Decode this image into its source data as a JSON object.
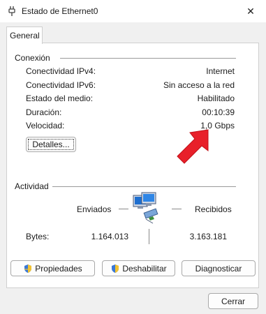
{
  "window": {
    "title": "Estado de Ethernet0",
    "close": "✕"
  },
  "tabs": [
    {
      "label": "General"
    }
  ],
  "connection": {
    "heading": "Conexión",
    "rows": [
      {
        "label": "Conectividad IPv4:",
        "value": "Internet"
      },
      {
        "label": "Conectividad IPv6:",
        "value": "Sin acceso a la red"
      },
      {
        "label": "Estado del medio:",
        "value": "Habilitado"
      },
      {
        "label": "Duración:",
        "value": "00:10:39"
      },
      {
        "label": "Velocidad:",
        "value": "1,0 Gbps"
      }
    ],
    "details_button": "Detalles..."
  },
  "activity": {
    "heading": "Actividad",
    "sent_label": "Enviados",
    "received_label": "Recibidos",
    "bytes_label": "Bytes:",
    "bytes_sent": "1.164.013",
    "bytes_received": "3.163.181"
  },
  "buttons": {
    "properties": "Propiedades",
    "disable": "Deshabilitar",
    "diagnose": "Diagnosticar",
    "close": "Cerrar"
  },
  "icons": {
    "title": "ethernet-plug-icon",
    "activity": "network-computers-icon",
    "shield": "uac-shield-icon",
    "annotation": "red-arrow-icon"
  },
  "colors": {
    "annotation_arrow": "#e8202a",
    "window_bg": "#f0f0f0"
  }
}
